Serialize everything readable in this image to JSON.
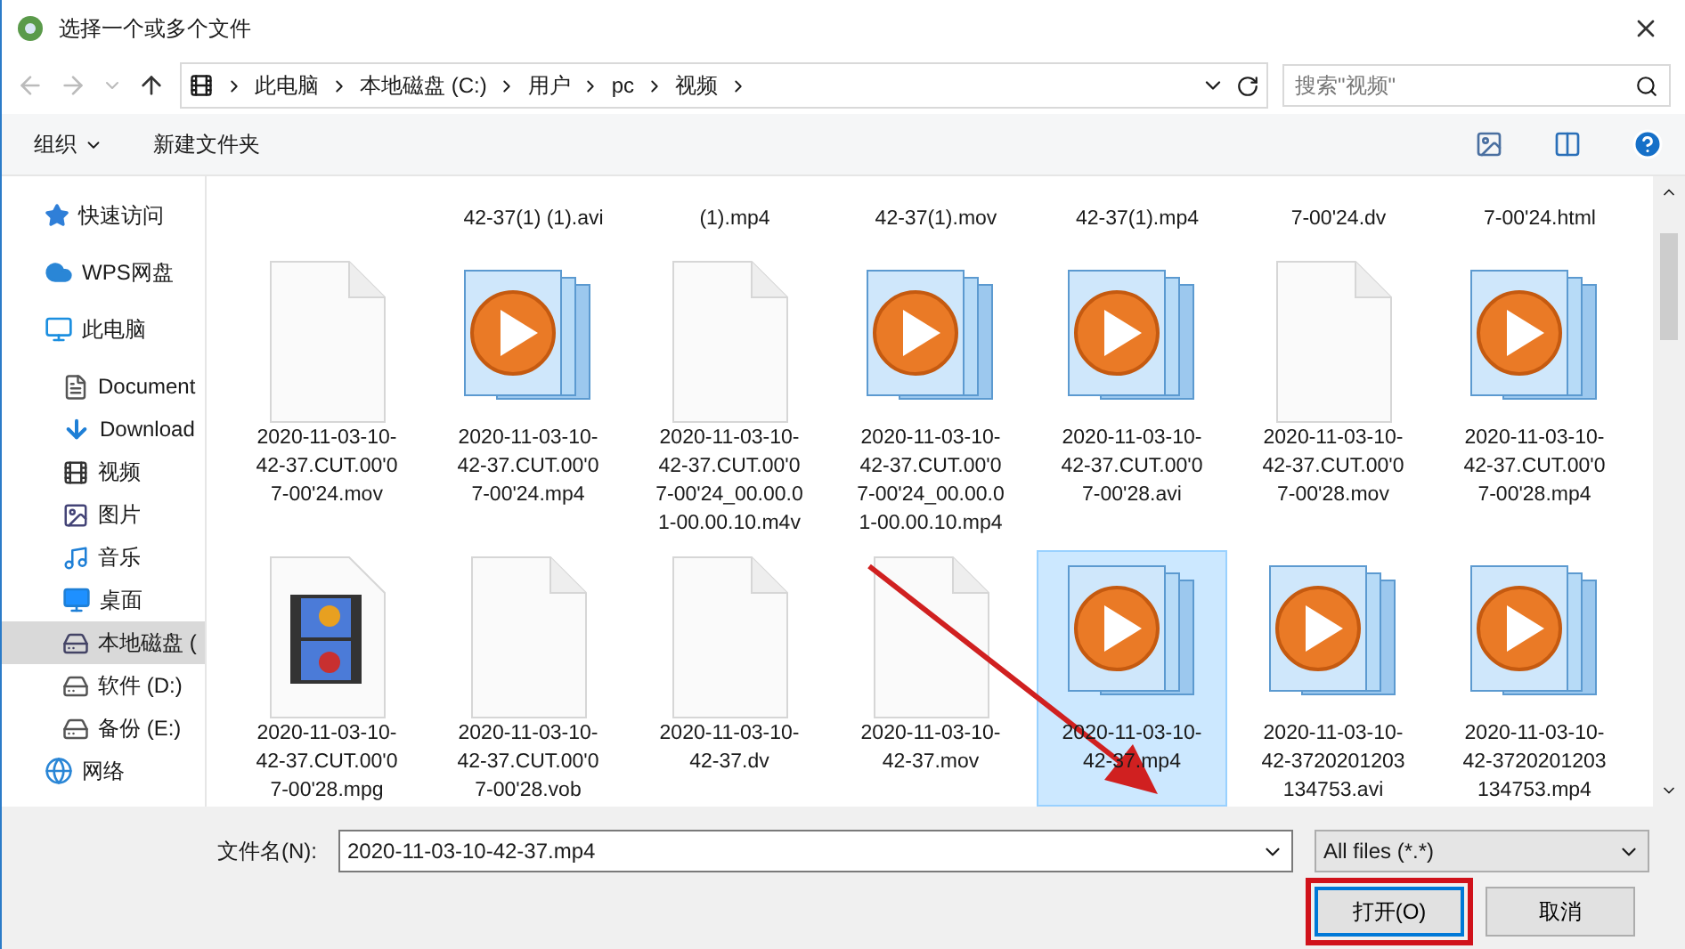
{
  "window": {
    "title": "选择一个或多个文件"
  },
  "address": {
    "segments": [
      "此电脑",
      "本地磁盘 (C:)",
      "用户",
      "pc",
      "视频"
    ]
  },
  "search": {
    "placeholder": "搜索\"视频\""
  },
  "toolbar": {
    "organize": "组织",
    "new_folder": "新建文件夹"
  },
  "sidebar": {
    "items": [
      {
        "label": "快速访问",
        "selected": false
      },
      {
        "label": "WPS网盘",
        "selected": false
      },
      {
        "label": "此电脑",
        "selected": false,
        "children": [
          {
            "label": "Document",
            "selected": false
          },
          {
            "label": "Download",
            "selected": false
          },
          {
            "label": "视频",
            "selected": false
          },
          {
            "label": "图片",
            "selected": false
          },
          {
            "label": "音乐",
            "selected": false
          },
          {
            "label": "桌面",
            "selected": false
          },
          {
            "label": "本地磁盘 (",
            "selected": true
          },
          {
            "label": "软件 (D:)",
            "selected": false
          },
          {
            "label": "备份 (E:)",
            "selected": false
          }
        ]
      },
      {
        "label": "网络",
        "selected": false
      }
    ]
  },
  "files_top_row": [
    {
      "lines": [
        "42-37(1) (1).avi"
      ]
    },
    {
      "lines": [
        "(1).mp4"
      ]
    },
    {
      "lines": [
        "42-37(1).mov"
      ]
    },
    {
      "lines": [
        "42-37(1).mp4"
      ]
    },
    {
      "lines": [
        "7-00'24.dv"
      ]
    },
    {
      "lines": [
        "7-00'24.html"
      ]
    }
  ],
  "files": [
    {
      "kind": "blank",
      "selected": false,
      "lines": [
        "2020-11-03-10-",
        "42-37.CUT.00'0",
        "7-00'24.mov"
      ]
    },
    {
      "kind": "video",
      "selected": false,
      "lines": [
        "2020-11-03-10-",
        "42-37.CUT.00'0",
        "7-00'24.mp4"
      ]
    },
    {
      "kind": "blank",
      "selected": false,
      "lines": [
        "2020-11-03-10-",
        "42-37.CUT.00'0",
        "7-00'24_00.00.0",
        "1-00.00.10.m4v"
      ]
    },
    {
      "kind": "video",
      "selected": false,
      "lines": [
        "2020-11-03-10-",
        "42-37.CUT.00'0",
        "7-00'24_00.00.0",
        "1-00.00.10.mp4"
      ]
    },
    {
      "kind": "video",
      "selected": false,
      "lines": [
        "2020-11-03-10-",
        "42-37.CUT.00'0",
        "7-00'28.avi"
      ]
    },
    {
      "kind": "blank",
      "selected": false,
      "lines": [
        "2020-11-03-10-",
        "42-37.CUT.00'0",
        "7-00'28.mov"
      ]
    },
    {
      "kind": "video",
      "selected": false,
      "lines": [
        "2020-11-03-10-",
        "42-37.CUT.00'0",
        "7-00'28.mp4"
      ]
    },
    {
      "kind": "film",
      "selected": false,
      "lines": [
        "2020-11-03-10-",
        "42-37.CUT.00'0",
        "7-00'28.mpg"
      ]
    },
    {
      "kind": "blank",
      "selected": false,
      "lines": [
        "2020-11-03-10-",
        "42-37.CUT.00'0",
        "7-00'28.vob"
      ]
    },
    {
      "kind": "blank",
      "selected": false,
      "lines": [
        "2020-11-03-10-",
        "42-37.dv"
      ]
    },
    {
      "kind": "blank",
      "selected": false,
      "lines": [
        "2020-11-03-10-",
        "42-37.mov"
      ]
    },
    {
      "kind": "video",
      "selected": true,
      "lines": [
        "2020-11-03-10-",
        "42-37.mp4"
      ]
    },
    {
      "kind": "video",
      "selected": false,
      "lines": [
        "2020-11-03-10-",
        "42-3720201203",
        "134753.avi"
      ]
    },
    {
      "kind": "video",
      "selected": false,
      "lines": [
        "2020-11-03-10-",
        "42-3720201203",
        "134753.mp4"
      ]
    }
  ],
  "footer": {
    "filename_label": "文件名(N):",
    "filename": "2020-11-03-10-42-37.mp4",
    "filter": "All files (*.*)",
    "open": "打开(O)",
    "cancel": "取消"
  }
}
